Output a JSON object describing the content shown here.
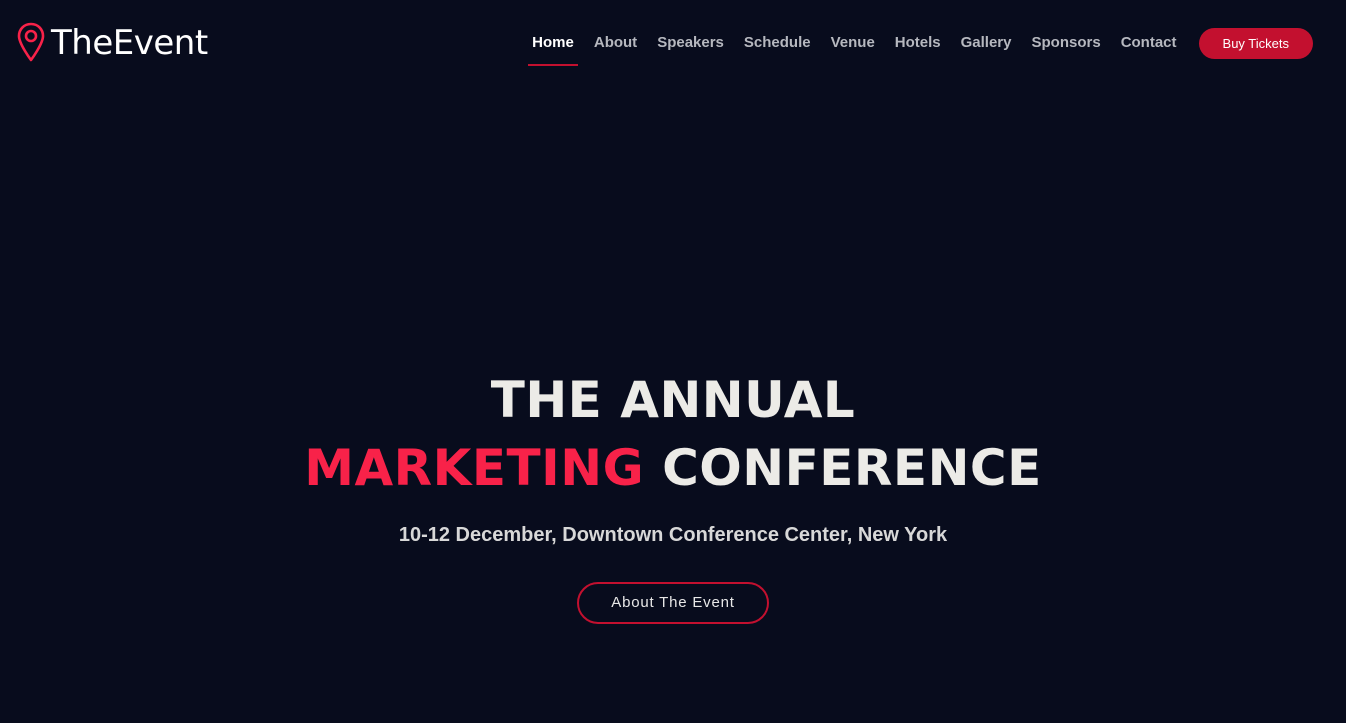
{
  "header": {
    "logo": {
      "icon": "map-pin-icon",
      "text_main": "The",
      "text_accent": "Event"
    },
    "nav": [
      {
        "label": "Home",
        "active": true
      },
      {
        "label": "About",
        "active": false
      },
      {
        "label": "Speakers",
        "active": false
      },
      {
        "label": "Schedule",
        "active": false
      },
      {
        "label": "Venue",
        "active": false
      },
      {
        "label": "Hotels",
        "active": false
      },
      {
        "label": "Gallery",
        "active": false
      },
      {
        "label": "Sponsors",
        "active": false
      },
      {
        "label": "Contact",
        "active": false
      }
    ],
    "cta_label": "Buy Tickets"
  },
  "hero": {
    "title_line1": "THE ANNUAL",
    "title_highlight": "MARKETING",
    "title_line2_rest": "CONFERENCE",
    "subtitle": "10-12 December, Downtown Conference Center, New York",
    "button_label": "About The Event"
  },
  "colors": {
    "background": "#080c1d",
    "accent": "#f82249",
    "button": "#c3102f",
    "text": "#ecebe7"
  }
}
